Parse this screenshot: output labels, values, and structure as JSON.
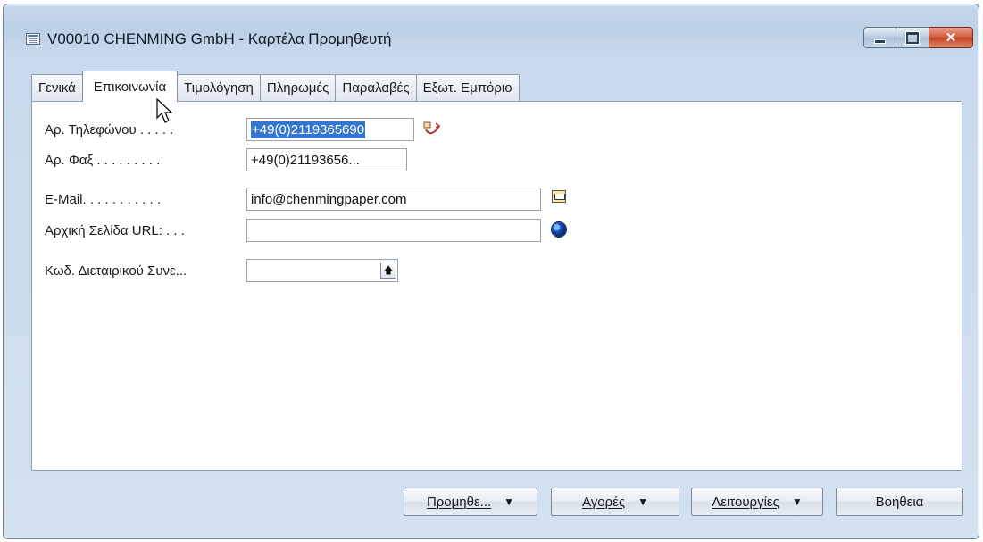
{
  "window": {
    "title": "V00010 CHENMING GmbH - Καρτέλα Προμηθευτή",
    "close_glyph": "✕"
  },
  "tabs": [
    {
      "label": "Γενικά"
    },
    {
      "label": "Επικοινωνία"
    },
    {
      "label": "Τιμολόγηση"
    },
    {
      "label": "Πληρωμές"
    },
    {
      "label": "Παραλαβές"
    },
    {
      "label": "Εξωτ. Εμπόριο"
    }
  ],
  "fields": {
    "phone": {
      "label": "Αρ. Τηλεφώνου . . . . .",
      "value": "+49(0)2119365690"
    },
    "fax": {
      "label": "Αρ. Φαξ . . . . . . . . .",
      "value": "+49(0)21193656..."
    },
    "email": {
      "label": "E-Mail. . . . . . . . . . .",
      "value": "info@chenmingpaper.com"
    },
    "homepage": {
      "label": "Αρχική Σελίδα URL: . . .",
      "value": ""
    },
    "ic_partner": {
      "label": "Κωδ. Διεταιρικού Συνε...",
      "value": "",
      "lookup_glyph": "🡅"
    }
  },
  "buttons": {
    "vendor": "Προμηθε...",
    "purchases": "Αγορές",
    "functions": "Λειτουργίες",
    "help": "Βοήθεια",
    "dropdown_glyph": "▼"
  },
  "icons": {
    "dial": "phone-dial-icon",
    "mail": "mail-icon",
    "web": "globe-icon"
  }
}
